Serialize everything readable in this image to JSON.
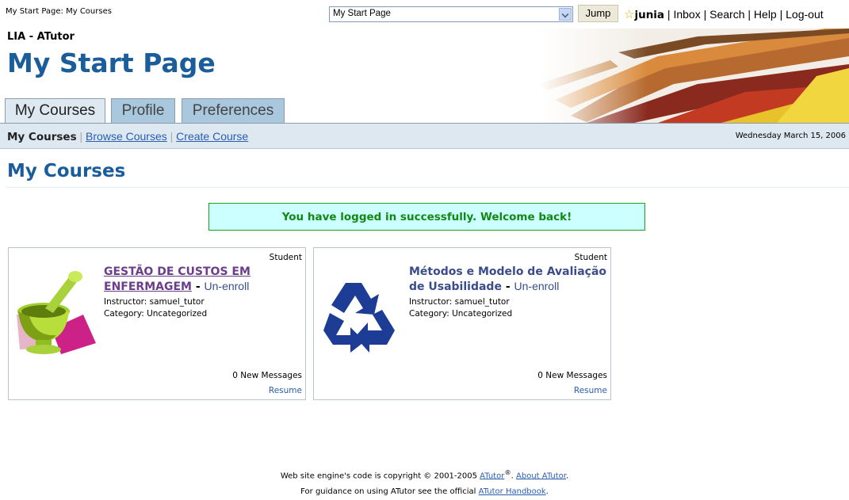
{
  "topbar": {
    "breadcrumb": "My Start Page: My Courses",
    "jump_value": "My Start Page",
    "jump_label": "Jump",
    "username": "junia",
    "links": [
      "Inbox",
      "Search",
      "Help",
      "Log-out"
    ]
  },
  "header": {
    "site_name": "LIA - ATutor",
    "page_title": "My Start Page",
    "tabs": [
      "My Courses",
      "Profile",
      "Preferences"
    ]
  },
  "subnav": {
    "current": "My Courses",
    "links": [
      "Browse Courses",
      "Create Course"
    ],
    "date": "Wednesday March 15, 2006"
  },
  "main": {
    "title": "My Courses",
    "feedback": "You have logged in successfully. Welcome back!",
    "courses": [
      {
        "role": "Student",
        "title": "GESTÃO DE CUSTOS EM ENFERMAGEM",
        "unenroll": "Un-enroll",
        "instructor": "Instructor: samuel_tutor",
        "category": "Category: Uncategorized",
        "messages": "0 New Messages",
        "resume": "Resume",
        "icon": "mortar-pestle-icon"
      },
      {
        "role": "Student",
        "title": "Métodos e Modelo de Avaliação de Usabilidade",
        "unenroll": "Un-enroll",
        "instructor": "Instructor: samuel_tutor",
        "category": "Category: Uncategorized",
        "messages": "0 New Messages",
        "resume": "Resume",
        "icon": "recycle-icon"
      }
    ]
  },
  "footer": {
    "line1_prefix": "Web site engine's code is copyright © 2001-2005",
    "atutor_link": "ATutor",
    "about_link": "About ATutor",
    "line2_prefix": "For guidance on using ATutor see the official",
    "handbook_link": "ATutor Handbook"
  },
  "colors": {
    "title_blue": "#1a5d9a",
    "tab_active": "#dde8f0",
    "tab_inactive": "#a9c7dd",
    "feedback_bg": "#ccffff",
    "feedback_text": "#118811",
    "link": "#2a5db0"
  }
}
